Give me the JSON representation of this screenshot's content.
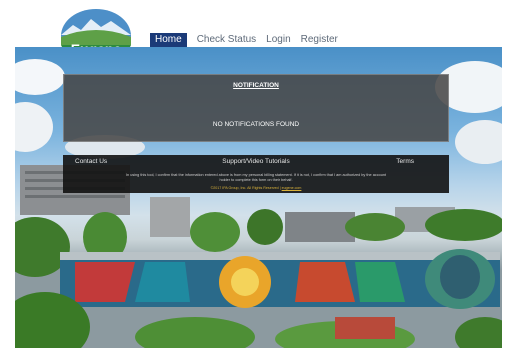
{
  "header": {
    "logo_text": "Eugene",
    "nav": [
      {
        "label": "Home",
        "active": true
      },
      {
        "label": "Check Status",
        "active": false
      },
      {
        "label": "Login",
        "active": false
      },
      {
        "label": "Register",
        "active": false
      }
    ]
  },
  "notification": {
    "title": "NOTIFICATION",
    "message": "NO NOTIFICATIONS FOUND"
  },
  "footer": {
    "contact_label": "Contact Us",
    "support_label": "Support/Video Tutorials",
    "terms_label": "Terms",
    "disclaimer": "In using this tool, I confirm that the information entered above is from my personal billing statement. If it is not, I confirm that I am authorized by the account holder to complete this form on their behalf.",
    "copyright": "©2017 IPA Group, Inc. All Rights Reserved",
    "copyright_link": "eugene.com"
  },
  "colors": {
    "nav_active_bg": "#1b3a78",
    "panel_bg": "#484848",
    "footer_bg": "#121212",
    "logo_green": "#2e8b3e",
    "copyright": "#d8b13a"
  }
}
